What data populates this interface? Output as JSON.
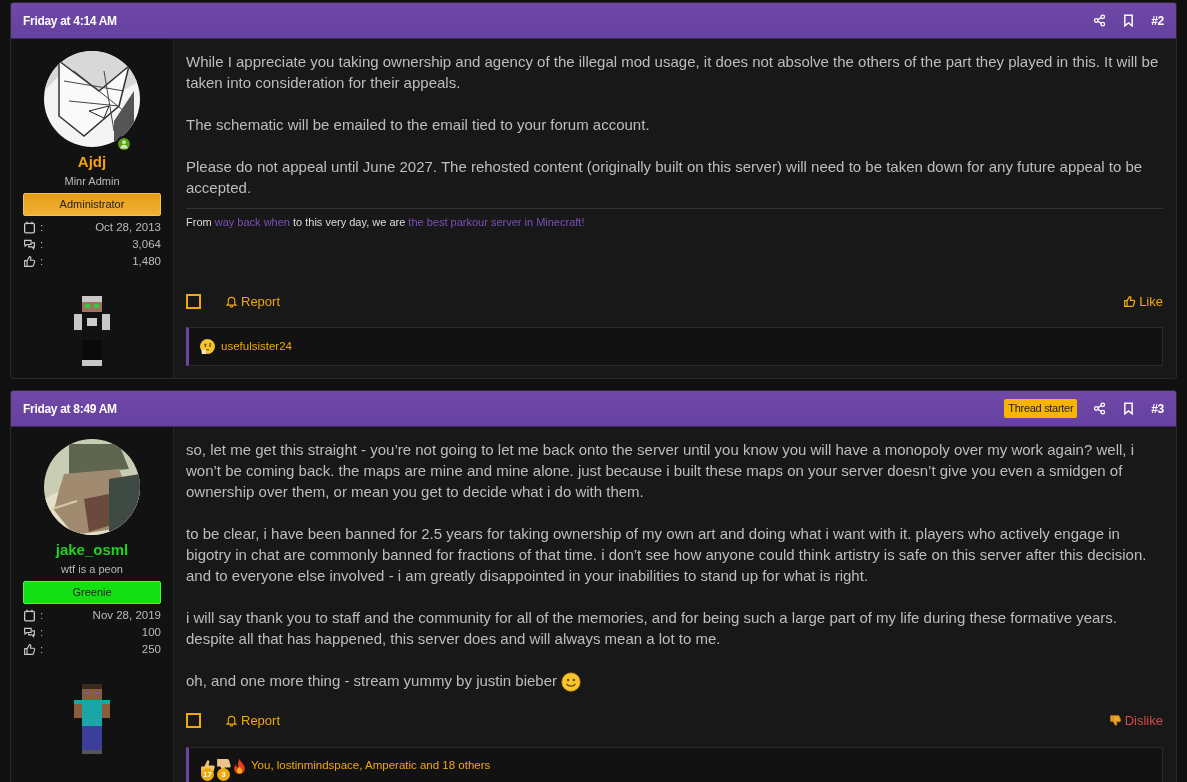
{
  "posts": [
    {
      "date": "Friday at 4:14 AM",
      "number": "#2",
      "user": {
        "name": "Ajdj",
        "online": true,
        "title": "Minr Admin",
        "banner": {
          "label": "Administrator",
          "kind": "admin"
        },
        "stats": [
          {
            "kind": "joined",
            "label": ":",
            "value": "Oct 28, 2013"
          },
          {
            "kind": "messages",
            "label": ":",
            "value": "3,064"
          },
          {
            "kind": "reactions",
            "label": ":",
            "value": "1,480"
          }
        ]
      },
      "paragraphs": [
        {
          "kind": "text",
          "text": "While I appreciate you taking ownership and agency of the illegal mod usage, it does not absolve the others of the part they played in this. It will be taken into consideration for their appeals."
        },
        {
          "kind": "text",
          "text": "The schematic will be emailed to the email tied to your forum account."
        },
        {
          "kind": "text",
          "text": "Please do not appeal until June 2027. The rehosted content (originally built on this server) will need to be taken down for any future appeal to be accepted."
        }
      ],
      "signature": [
        {
          "text": "From ",
          "link": false
        },
        {
          "text": "way back when",
          "link": true
        },
        {
          "text": " to this very day, we are ",
          "link": false
        },
        {
          "text": "the best parkour server in Minecraft!",
          "link": true
        }
      ],
      "selected": false,
      "report": "Report",
      "reaction_button": {
        "kind": "like",
        "label": "Like"
      },
      "reactions": {
        "items": [
          {
            "kind": "thinking"
          }
        ],
        "text": "usefulsister24"
      }
    },
    {
      "date": "Friday at 8:49 AM",
      "starter_badge": "Thread starter",
      "number": "#3",
      "user": {
        "name": "jake_osml",
        "online": false,
        "title": "wtf is a peon",
        "banner": {
          "label": "Greenie",
          "kind": "greenie"
        },
        "stats": [
          {
            "kind": "joined",
            "label": ":",
            "value": "Nov 28, 2019"
          },
          {
            "kind": "messages",
            "label": ":",
            "value": "100"
          },
          {
            "kind": "reactions",
            "label": ":",
            "value": "250"
          }
        ]
      },
      "paragraphs": [
        {
          "kind": "text",
          "text": "so, let me get this straight - you’re not going to let me back onto the server until you know you will have a monopoly over my work again? well, i won’t be coming back. the maps are mine and mine alone. just because i built these maps on your server doesn’t give you even a smidgen of ownership over them, or mean you get to decide what i do with them."
        },
        {
          "kind": "text",
          "text": "to be clear, i have been banned for 2.5 years for taking ownership of my own art and doing what i want with it. players who actively engage in bigotry in chat are commonly banned for fractions of that time. i don’t see how anyone could think artistry is safe on this server after this decision. and to everyone else involved - i am greatly disappointed in your inabilities to stand up for what is right."
        },
        {
          "kind": "text",
          "text": "i will say thank you to staff and the community for all of the memories, and for being such a large part of my life during these formative years. despite all that has happened, this server does and will always mean a lot to me."
        },
        {
          "kind": "smile",
          "text": "oh, and one more thing - stream yummy by justin bieber"
        }
      ],
      "selected": false,
      "report": "Report",
      "reaction_button": {
        "kind": "dislike",
        "label": "Dislike"
      },
      "reactions": {
        "items": [
          {
            "kind": "like",
            "count": "17"
          },
          {
            "kind": "dislike",
            "count": "3"
          },
          {
            "kind": "fire"
          }
        ],
        "text": "You, lostinmindspace, Amperatic and 18 others"
      }
    }
  ]
}
